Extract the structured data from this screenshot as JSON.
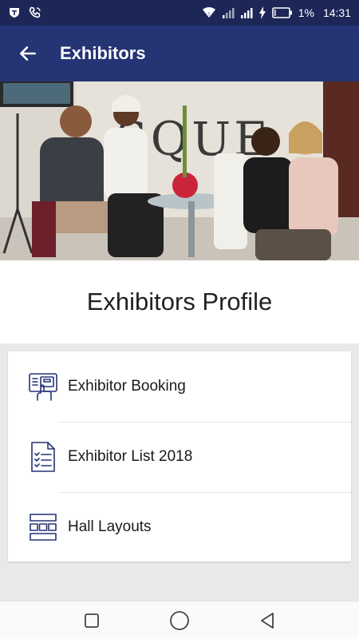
{
  "status_bar": {
    "battery": "1%",
    "time": "14:31",
    "icons": [
      "shield-icon",
      "phone-icon",
      "wifi-icon",
      "signal-icon",
      "signal-icon",
      "charging-icon",
      "battery-icon"
    ]
  },
  "app_bar": {
    "title": "Exhibitors",
    "back_icon": "arrow-left-icon"
  },
  "hero": {
    "banner_text": "SQUE"
  },
  "profile": {
    "title": "Exhibitors Profile"
  },
  "menu": {
    "items": [
      {
        "label": "Exhibitor Booking",
        "icon": "booking-icon"
      },
      {
        "label": "Exhibitor List 2018",
        "icon": "checklist-document-icon"
      },
      {
        "label": "Hall Layouts",
        "icon": "hall-layout-icon"
      }
    ]
  },
  "nav_bar": {
    "icons": [
      "recent-apps-icon",
      "home-icon",
      "back-icon"
    ]
  },
  "colors": {
    "status_bar": "#1c2757",
    "app_bar": "#253474",
    "icon_stroke": "#253474",
    "background": "#e9e9e9"
  }
}
